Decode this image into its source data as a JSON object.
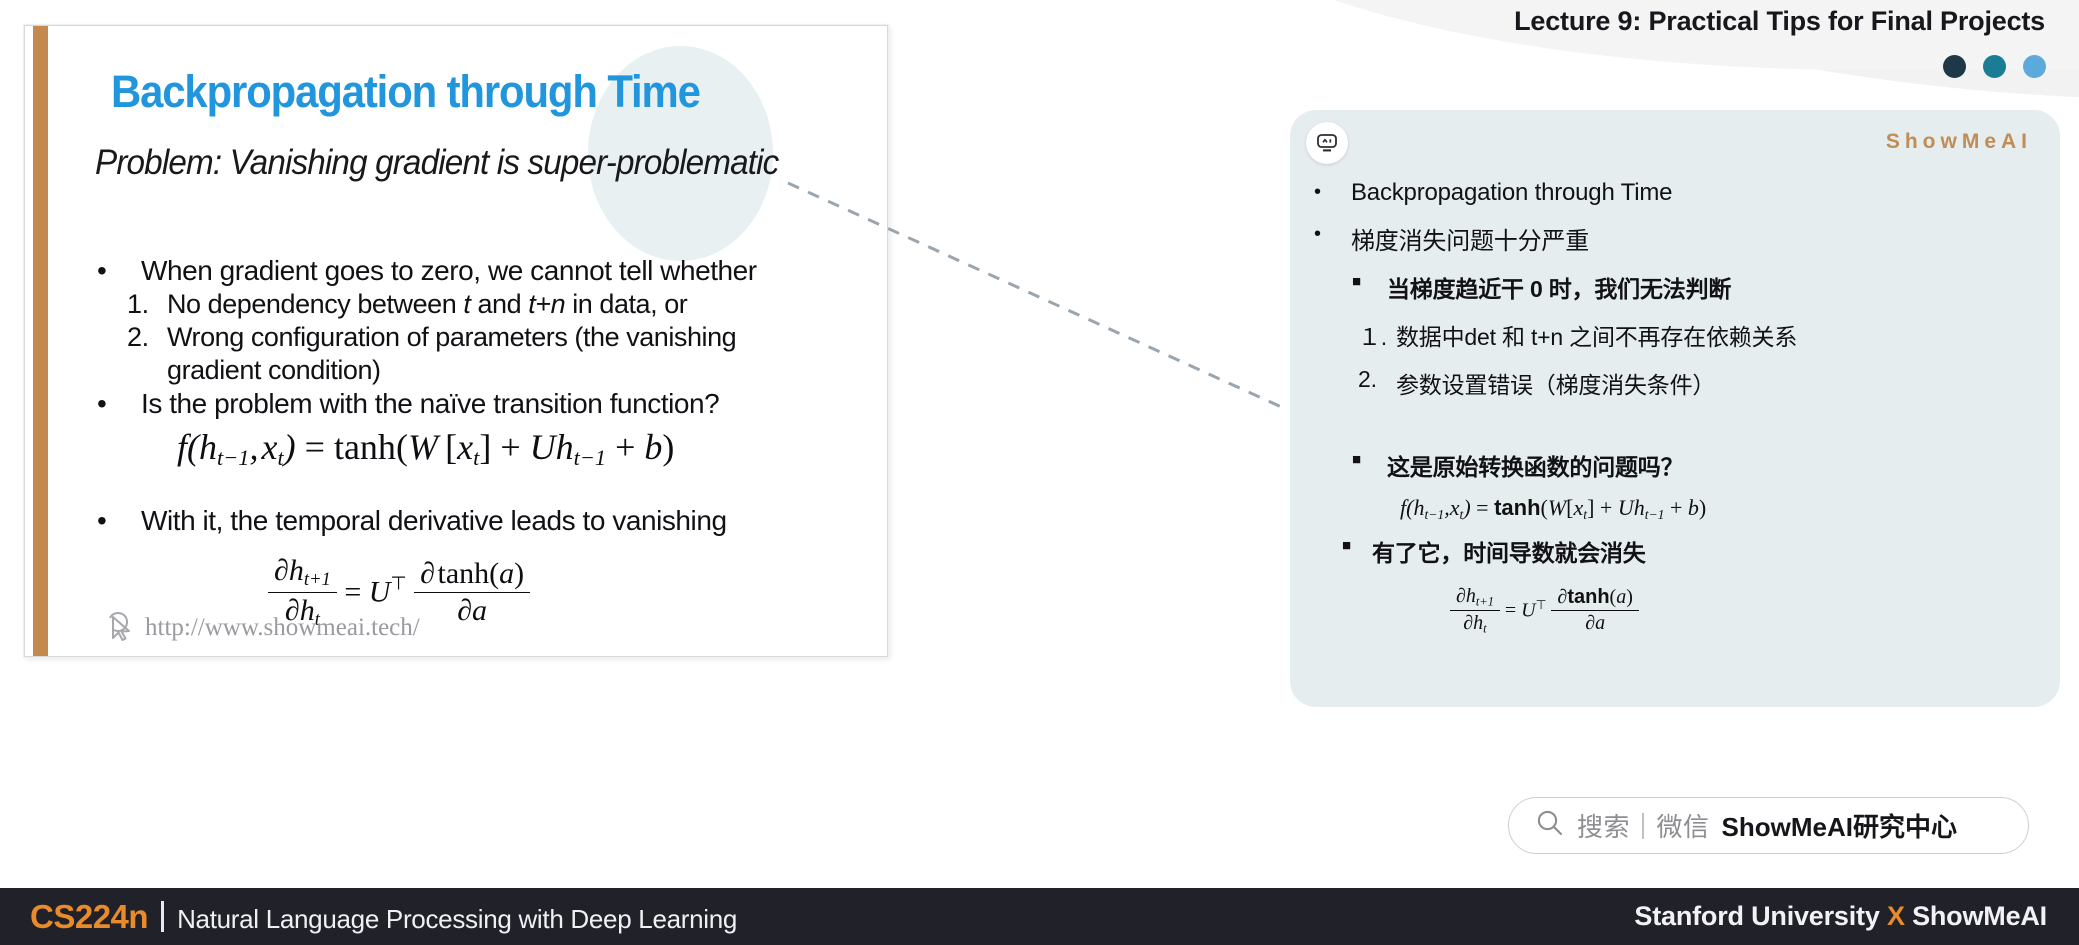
{
  "header": {
    "lecture_title": "Lecture 9: Practical Tips for Final Projects",
    "dots": [
      {
        "name": "dot-dark",
        "color": "#1d3846"
      },
      {
        "name": "dot-teal",
        "color": "#1b7d95"
      },
      {
        "name": "dot-lightblue",
        "color": "#5ca9db"
      }
    ]
  },
  "slide": {
    "accent_color": "#c4894f",
    "title": "Backpropagation through Time",
    "title_color": "#2196dd",
    "subtitle_plain": "Problem: Vanishing gradient is ",
    "subtitle_emph": "super-problematic",
    "bullets": [
      {
        "marker": "•",
        "level": 1,
        "text": "When gradient goes to zero, we cannot tell whether"
      },
      {
        "marker": "1.",
        "level": 2,
        "text_pre": "No dependency between ",
        "em1": "t",
        "text_mid": " and ",
        "em2": "t+n",
        "text_post": " in data, or"
      },
      {
        "marker": "2.",
        "level": 2,
        "text": "Wrong configuration of parameters (the vanishing"
      },
      {
        "marker": "",
        "level": 2,
        "text": "gradient condition)"
      },
      {
        "marker": "•",
        "level": 1,
        "text": "Is the problem with the naïve transition function?"
      }
    ],
    "equation_1": "f(h_{t-1}, x_t) = tanh(W [x_t] + U h_{t-1} + b)",
    "bullet_after_eq": {
      "marker": "•",
      "text": "With it, the temporal derivative leads to vanishing"
    },
    "equation_2": "∂h_{t+1}/∂h_t = Uᵀ ∂tanh(a)/∂a",
    "watermark_url": "http://www.showmeai.tech/"
  },
  "notes_panel": {
    "background": "#e6edef",
    "bot_icon": "robot-face-icon",
    "brand": "ShowMeAI",
    "brand_color": "#c08d57",
    "items": [
      {
        "level": 1,
        "marker": "•",
        "text": "Backpropagation through Time"
      },
      {
        "level": 1,
        "marker": "•",
        "text": "梯度消失问题十分严重"
      },
      {
        "level": 2,
        "marker": "■",
        "text": "当梯度趋近干 0 时，我们无法判断"
      },
      {
        "level": 3,
        "marker": "１.",
        "text": "数据中det 和 t+n 之间不再存在依赖关系"
      },
      {
        "level": 3,
        "marker": "2.",
        "text": "参数设置错误（梯度消失条件）"
      },
      {
        "level": 2,
        "marker": "■",
        "text": "这是原始转换函数的问题吗？"
      },
      {
        "level": 2,
        "marker": "■",
        "text": "有了它，时间导数就会消失"
      }
    ],
    "equation_1": "f(h_{t-1},x_t) = tanh(W[x_t] + Uh_{t-1} + b)",
    "equation_2": "∂h_{t+1}/∂h_t = Uᵀ ∂tanh(a)/∂a"
  },
  "search": {
    "icon": "magnifier-icon",
    "label": "搜索｜微信",
    "strong": "ShowMeAI研究中心"
  },
  "footer": {
    "code": "CS224n",
    "subtitle": "Natural Language Processing with Deep Learning",
    "right_pre": "Stanford University ",
    "right_x": "X",
    "right_post": " ShowMeAI",
    "accent": "#e98a2b",
    "background": "#212129"
  },
  "math_symbols": {
    "f": "f",
    "tanh": "tanh",
    "W": "W",
    "U": "U",
    "b": "b",
    "a": "a",
    "h": "h",
    "x": "x",
    "partial": "∂",
    "transpose": "⊤",
    "eq": "=",
    "plus": "+",
    "lparen": "(",
    "rparen": ")",
    "lbrack": "[",
    "rbrack": "]",
    "comma": ",",
    "tsub": "t",
    "tm1": "t−1",
    "tp1": "t+1"
  }
}
